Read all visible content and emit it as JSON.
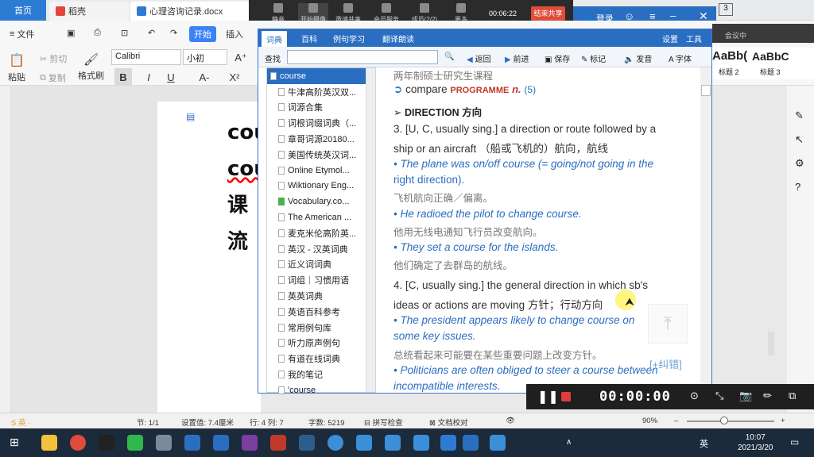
{
  "wps": {
    "home_tab": "首页",
    "tabs": [
      "稻壳",
      "心理咨询记录.docx"
    ],
    "ribbon": {
      "file": "文件",
      "start": "开始",
      "insert": "插入",
      "paste": "粘贴",
      "cut": "剪切",
      "copy": "复制",
      "format_painter": "格式刷",
      "font": "Calibri",
      "size": "小初",
      "styles": [
        "AaBb(",
        "AaBbC"
      ],
      "style_names": [
        "标题 2",
        "标题 3"
      ]
    }
  },
  "doc": {
    "lines": [
      "cou",
      "cou",
      "课",
      "流"
    ]
  },
  "meeting": {
    "buttons": [
      "静音",
      "开始摄像头",
      "邀请共享",
      "会员服务",
      "成员(2/2)",
      "更多"
    ],
    "timer": "00:06:22",
    "end": "结束共享",
    "side": "会议中"
  },
  "dict": {
    "login": "登录",
    "tabs": [
      "词典",
      "百科",
      "例句学习",
      "翻译朗读"
    ],
    "right_tabs": [
      "设置",
      "工具"
    ],
    "search_label": "查找",
    "search_value": "",
    "tools": [
      "返回",
      "前进",
      "保存",
      "标记",
      "发音",
      "字体"
    ],
    "list": [
      "course",
      "牛津高阶英汉双...",
      "词源合集",
      "词根词缀词典（...",
      "章哥词源20180...",
      "美国传统英汉词...",
      "Online Etymol...",
      "Wiktionary Eng...",
      "Vocabulary.co...",
      "The American ...",
      "麦克米伦高阶英...",
      "英汉 - 汉英词典",
      "近义词词典",
      "词组｜习惯用语",
      "英英词典",
      "英语百科参考",
      "常用例句库",
      "听力原声例句",
      "有道在线词典",
      "我的笔记",
      "'course"
    ],
    "content": {
      "l1": "两年制硕士研究生课程",
      "compare": "compare",
      "prog": "PROGRAMME",
      "n": "n.",
      "num5": "(5)",
      "dir_h": "➢ DIRECTION 方向",
      "s3": "3. [U, C, usually sing.] a direction or route followed by a",
      "s3b": "ship or an aircraft （船或飞机的）航向，航线",
      "e1a": "• The plane was on/off course (= going/not going in the",
      "e1b": "right direction).",
      "c1": "飞机航向正确／偏离。",
      "e2": "• He radioed the pilot to change course.",
      "c2": "他用无线电通知飞行员改变航向。",
      "e3": "• They set a course for the islands.",
      "c3": "他们确定了去群岛的航线。",
      "s4": "4. [C, usually sing.] the general direction in which sb's",
      "s4b": "ideas or actions are moving 方针；行动方向",
      "e4a": "• The president appears likely to change course on",
      "e4b": "some key issues.",
      "c4": "总统看起来可能要在某些重要问题上改变方针。",
      "e5a": "• Politicians are often obliged to steer a course between",
      "e5b": "incompatible interests."
    },
    "correct": "[+纠错]"
  },
  "recorder": {
    "time": "00:00:00"
  },
  "status": {
    "items": [
      "节: 1/1",
      "设置值: 7.4厘米",
      "行: 4  列: 7",
      "字数: 5219",
      "拼写检查",
      "文档校对"
    ],
    "zoom": "90%"
  },
  "taskbar": {
    "ime": "英",
    "clock_time": "10:07",
    "clock_date": "2021/3/20",
    "lang": "英"
  }
}
